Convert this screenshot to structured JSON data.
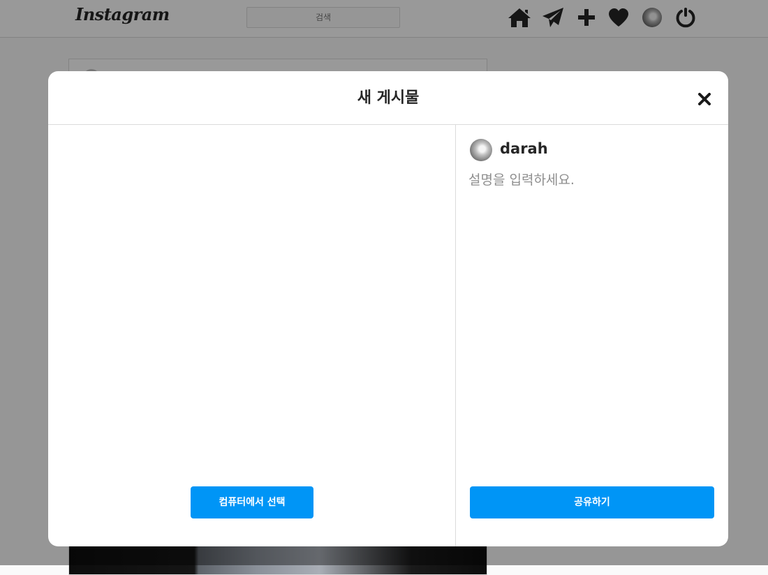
{
  "app": {
    "logo": "Instagram",
    "search_placeholder": "검색"
  },
  "nav": {
    "icons": [
      "home-icon",
      "send-icon",
      "plus-icon",
      "heart-icon",
      "profile-avatar",
      "power-icon"
    ]
  },
  "modal": {
    "title": "새 게시물",
    "close_icon": "close-icon",
    "select_button_label": "컴퓨터에서 선택",
    "user": {
      "username": "darah"
    },
    "caption_placeholder": "설명을 입력하세요.",
    "share_button_label": "공유하기"
  },
  "colors": {
    "accent": "#0095f6",
    "overlay": "rgba(0,0,0,0.4)",
    "text": "#262626"
  }
}
